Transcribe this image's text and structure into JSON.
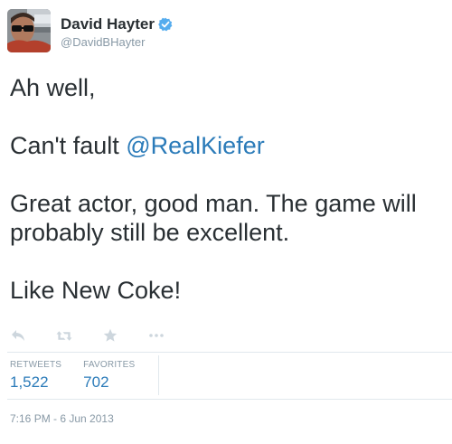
{
  "user": {
    "fullname": "David Hayter",
    "screenname": "@DavidBHayter",
    "verified": true
  },
  "tweet": {
    "line1": "Ah well,",
    "line2_prefix": "Can't fault ",
    "line2_mention": "@RealKiefer",
    "line3": "Great actor, good man.  The game will",
    "line4": "probably still be excellent.",
    "line5": "Like New Coke!"
  },
  "actions": {
    "reply_icon": "reply-icon",
    "retweet_icon": "retweet-icon",
    "favorite_icon": "star-icon",
    "more_icon": "more-icon"
  },
  "stats": {
    "retweets_label": "RETWEETS",
    "retweets_value": "1,522",
    "favorites_label": "FAVORITES",
    "favorites_value": "702"
  },
  "timestamp": "7:16 PM - 6 Jun 2013",
  "colors": {
    "link": "#2b7bb9",
    "muted": "#8899a6",
    "text": "#292f33",
    "verified": "#55acee"
  }
}
